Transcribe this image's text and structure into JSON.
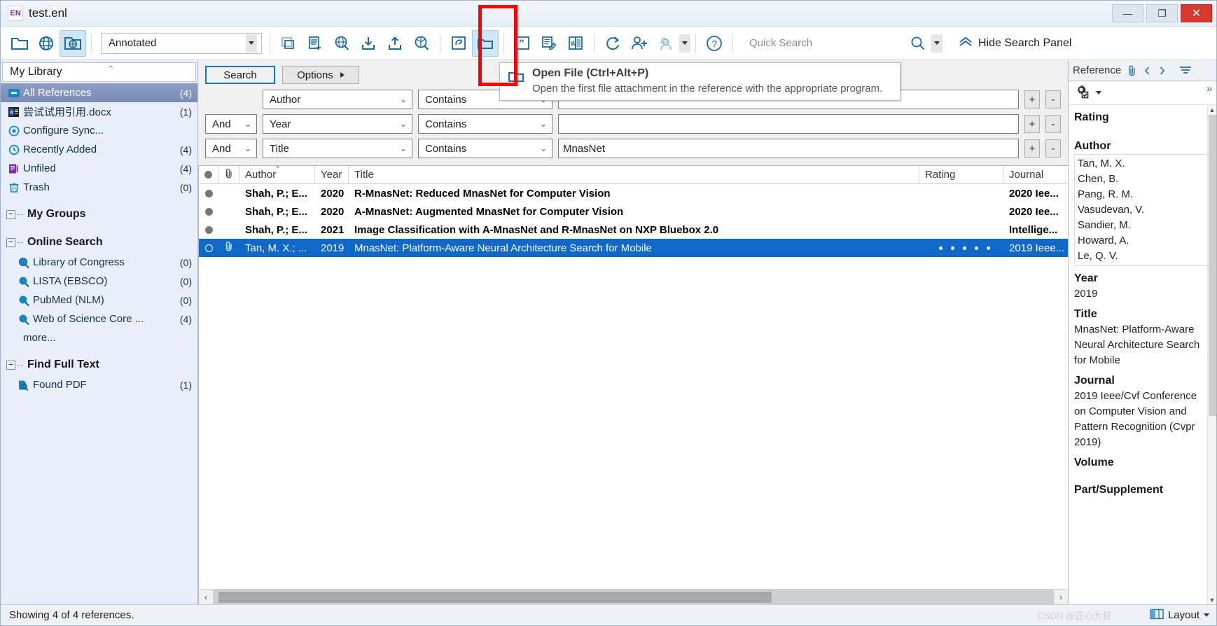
{
  "window": {
    "title": "test.enl",
    "logo_text": "EN",
    "minimize": "—",
    "maximize": "❐",
    "close": "✕"
  },
  "toolbar": {
    "style_selected": "Annotated",
    "quick_search_placeholder": "Quick Search",
    "hide_search_panel": "Hide Search Panel",
    "icons": [
      {
        "name": "open-library-folder-icon",
        "title": "Open Library"
      },
      {
        "name": "online-search-globe-icon",
        "title": "Online Search"
      },
      {
        "name": "integrated-library-globe-folder-icon",
        "title": "Integrated Library & Online Search",
        "active": true
      },
      {
        "name": "copy-references-icon",
        "title": "Copy References"
      },
      {
        "name": "new-reference-icon",
        "title": "New Reference"
      },
      {
        "name": "online-search-magnifier-icon",
        "title": "Online Search"
      },
      {
        "name": "import-download-icon",
        "title": "Import"
      },
      {
        "name": "export-upload-icon",
        "title": "Export"
      },
      {
        "name": "find-full-text-pdf-icon",
        "title": "Find Full Text"
      },
      {
        "name": "open-url-link-icon",
        "title": "Open URL"
      },
      {
        "name": "open-file-folder-icon",
        "title": "Open File",
        "active": true
      },
      {
        "name": "insert-citation-quote-icon",
        "title": "Insert Citation"
      },
      {
        "name": "format-bibliography-icon",
        "title": "Format Bibliography"
      },
      {
        "name": "cite-while-you-write-word-icon",
        "title": "Go to Word Processor"
      },
      {
        "name": "sync-icon",
        "title": "Sync"
      },
      {
        "name": "share-library-icon",
        "title": "Share Library"
      },
      {
        "name": "activity-feed-icon",
        "title": "Activity Feed"
      },
      {
        "name": "help-icon",
        "title": "Help"
      }
    ]
  },
  "tooltip": {
    "title": "Open File (Ctrl+Alt+P)",
    "description": "Open the first file attachment in the reference with the appropriate program."
  },
  "sidebar": {
    "library_header": "My Library",
    "items": [
      {
        "label": "All References",
        "count": "(4)",
        "icon": "all-references-icon",
        "selected": true
      },
      {
        "label": "尝试试用引用.docx",
        "count": "(1)",
        "icon": "word-document-icon",
        "selected": false
      },
      {
        "label": "Configure Sync...",
        "count": "",
        "icon": "sync-icon",
        "selected": false
      },
      {
        "label": "Recently Added",
        "count": "(4)",
        "icon": "recently-added-clock-icon",
        "selected": false
      },
      {
        "label": "Unfiled",
        "count": "(4)",
        "icon": "unfiled-icon",
        "selected": false
      },
      {
        "label": "Trash",
        "count": "(0)",
        "icon": "trash-icon",
        "selected": false
      }
    ],
    "groups": [
      {
        "label": "My Groups",
        "children": []
      },
      {
        "label": "Online Search",
        "children": [
          {
            "label": "Library of Congress",
            "count": "(0)",
            "icon": "online-search-globe-icon"
          },
          {
            "label": "LISTA (EBSCO)",
            "count": "(0)",
            "icon": "online-search-globe-icon"
          },
          {
            "label": "PubMed (NLM)",
            "count": "(0)",
            "icon": "online-search-globe-icon"
          },
          {
            "label": "Web of Science Core ...",
            "count": "(4)",
            "icon": "online-search-globe-icon"
          }
        ],
        "more": "more..."
      },
      {
        "label": "Find Full Text",
        "children": [
          {
            "label": "Found PDF",
            "count": "(1)",
            "icon": "found-pdf-icon"
          }
        ]
      }
    ]
  },
  "search_panel": {
    "search_button": "Search",
    "options_button": "Options",
    "rows": [
      {
        "bool": "",
        "field": "Author",
        "op": "Contains",
        "value": ""
      },
      {
        "bool": "And",
        "field": "Year",
        "op": "Contains",
        "value": ""
      },
      {
        "bool": "And",
        "field": "Title",
        "op": "Contains",
        "value": "MnasNet"
      }
    ],
    "add_label": "+",
    "remove_label": "-"
  },
  "table": {
    "columns": [
      "",
      "",
      "Author",
      "Year",
      "Title",
      "Rating",
      "Journal"
    ],
    "sorted_column": "Author",
    "rows": [
      {
        "read": "read",
        "attachment": "",
        "author": "Shah, P.; E...",
        "year": "2020",
        "title": "R-MnasNet: Reduced MnasNet for Computer Vision",
        "rating": 0,
        "journal": "2020 Iee...",
        "selected": false
      },
      {
        "read": "read",
        "attachment": "",
        "author": "Shah, P.; E...",
        "year": "2020",
        "title": "A-MnasNet: Augmented MnasNet for Computer Vision",
        "rating": 0,
        "journal": "2020 Iee...",
        "selected": false
      },
      {
        "read": "read",
        "attachment": "",
        "author": "Shah, P.; E...",
        "year": "2021",
        "title": "Image Classification with A-MnasNet and R-MnasNet on NXP Bluebox 2.0",
        "rating": 0,
        "journal": "Intellige...",
        "selected": false
      },
      {
        "read": "unread",
        "attachment": "paperclip-icon",
        "author": "Tan, M. X.; ...",
        "year": "2019",
        "title": "MnasNet: Platform-Aware Neural Architecture Search for Mobile",
        "rating": 5,
        "journal": "2019 Ieee...",
        "selected": true
      }
    ]
  },
  "reference_panel": {
    "tab_label": "Reference",
    "attachment_icon": "paperclip-icon",
    "prev_icon": "chevron-left-icon",
    "next_icon": "chevron-right-icon",
    "filter_icon": "filter-icon",
    "settings_icon": "settings-gear-icon",
    "fields": [
      {
        "label": "Rating",
        "value": ""
      },
      {
        "label": "Author",
        "value": "Tan, M. X.\nChen, B.\nPang, R. M.\nVasudevan, V.\nSandier, M.\nHoward, A.\nLe, Q. V."
      },
      {
        "label": "Year",
        "value": "2019"
      },
      {
        "label": "Title",
        "value": "MnasNet: Platform-Aware Neural Architecture Search for Mobile"
      },
      {
        "label": "Journal",
        "value": "2019 Ieee/Cvf Conference on Computer Vision and Pattern Recognition (Cvpr 2019)"
      },
      {
        "label": "Volume",
        "value": ""
      },
      {
        "label": "Part/Supplement",
        "value": ""
      }
    ],
    "authors": [
      "Tan, M. X.",
      "Chen, B.",
      "Pang, R. M.",
      "Vasudevan, V.",
      "Sandier, M.",
      "Howard, A.",
      "Le, Q. V."
    ],
    "year_value": "2019",
    "title_value": "MnasNet: Platform-Aware Neural Architecture Search for Mobile",
    "journal_value": "2019 Ieee/Cvf Conference on Computer Vision and Pattern Recognition (Cvpr 2019)"
  },
  "status": {
    "text": "Showing 4 of 4 references.",
    "layout_label": "Layout",
    "watermark": "CSDN @匠心大叔"
  }
}
